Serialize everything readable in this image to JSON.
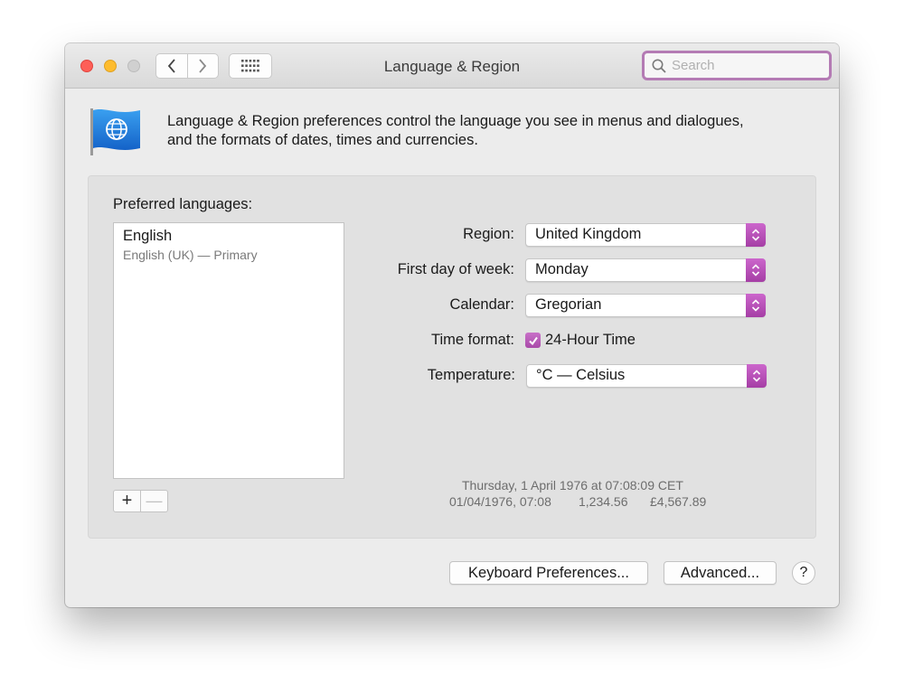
{
  "window": {
    "title": "Language & Region"
  },
  "search": {
    "placeholder": "Search"
  },
  "intro": {
    "line1": "Language & Region preferences control the language you see in menus and dialogues,",
    "line2": "and the formats of dates, times and currencies."
  },
  "languages": {
    "label": "Preferred languages:",
    "items": [
      {
        "name": "English",
        "detail": "English (UK) — Primary"
      }
    ],
    "add_label": "+",
    "remove_label": "—"
  },
  "settings": {
    "region": {
      "label": "Region:",
      "value": "United Kingdom"
    },
    "first_day": {
      "label": "First day of week:",
      "value": "Monday"
    },
    "calendar": {
      "label": "Calendar:",
      "value": "Gregorian"
    },
    "time_format": {
      "label": "Time format:",
      "checkbox_label": "24-Hour Time",
      "checked": true
    },
    "temperature": {
      "label": "Temperature:",
      "value": "°C — Celsius"
    }
  },
  "sample": {
    "line1": "Thursday, 1 April 1976 at 07:08:09 CET",
    "datetime": "01/04/1976, 07:08",
    "number": "1,234.56",
    "currency": "£4,567.89"
  },
  "buttons": {
    "keyboard": "Keyboard Preferences...",
    "advanced": "Advanced...",
    "help": "?"
  },
  "colors": {
    "accent": "#b45cb4",
    "search_ring": "#b47bb4",
    "close": "#fe5f57",
    "minimize": "#febc2e",
    "zoom": "#d0d0d0"
  },
  "icons": [
    "back-chevron-icon",
    "forward-chevron-icon",
    "grid-icon",
    "magnifier-icon",
    "globe-flag-icon",
    "updown-arrows-icon",
    "checkmark-icon"
  ]
}
